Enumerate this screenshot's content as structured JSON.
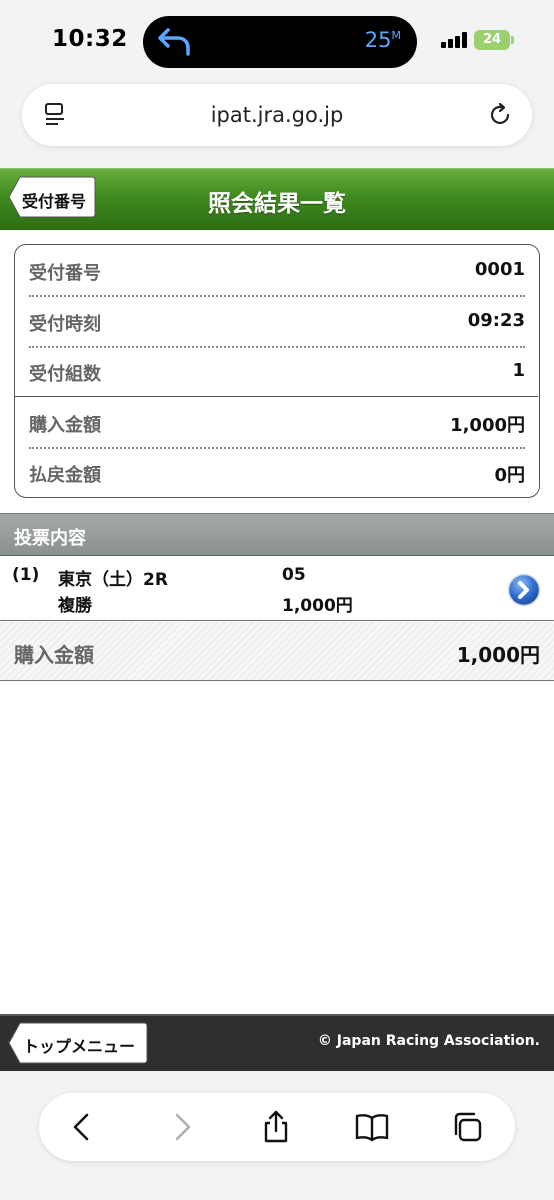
{
  "status_bar": {
    "time": "10:32",
    "island_text": "25",
    "island_sup": "M",
    "battery": "24"
  },
  "browser": {
    "url": "ipat.jra.go.jp"
  },
  "header": {
    "back_label": "受付番号",
    "title": "照会結果一覧"
  },
  "info": {
    "rows": [
      {
        "label": "受付番号",
        "value": "0001"
      },
      {
        "label": "受付時刻",
        "value": "09:23"
      },
      {
        "label": "受付組数",
        "value": "1"
      },
      {
        "label": "購入金額",
        "value": "1,000円"
      },
      {
        "label": "払戻金額",
        "value": "0円"
      }
    ]
  },
  "section": {
    "title": "投票内容"
  },
  "bet": {
    "number": "(1)",
    "race": "東京（土）2R",
    "type": "複勝",
    "horse": "05",
    "amount": "1,000円"
  },
  "total": {
    "label": "購入金額",
    "value": "1,000円"
  },
  "footer": {
    "top_menu_label": "トップメニュー",
    "copyright": "© Japan Racing Association."
  },
  "colors": {
    "header_green": "#3f8a1f",
    "section_gray": "#959b99",
    "footer_dark": "#2f2f2f",
    "arrow_blue": "#2f6fd0"
  },
  "icons": [
    "back-arrow-icon",
    "menu-icon",
    "reload-icon",
    "chevron-right-icon",
    "back-icon",
    "forward-icon",
    "share-icon",
    "bookmarks-icon",
    "tabs-icon"
  ]
}
